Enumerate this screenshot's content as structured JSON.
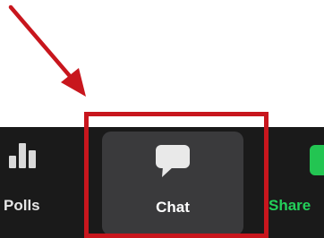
{
  "toolbar": {
    "polls_label": "Polls",
    "chat_label": "Chat",
    "share_label": "Share"
  },
  "icons": {
    "polls": "bar-chart-icon",
    "chat": "speech-bubble-icon",
    "share": "share-screen-icon"
  },
  "colors": {
    "toolbar_bg": "#1a1a1a",
    "hover_bg": "#3a3a3c",
    "share_green": "#23c552",
    "highlight_red": "#c8161d"
  }
}
